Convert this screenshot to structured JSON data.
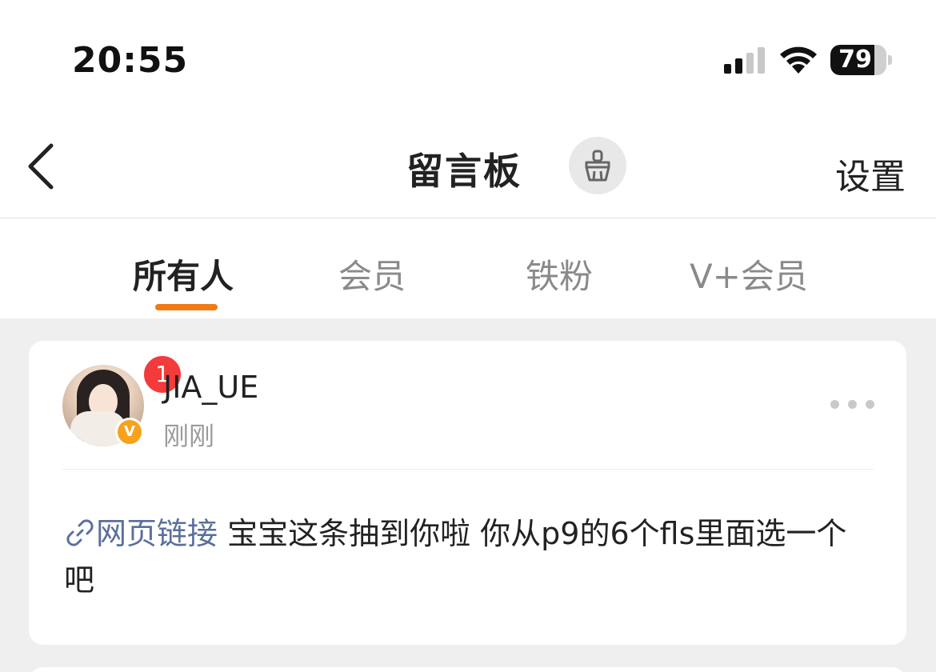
{
  "status_bar": {
    "time": "20:55",
    "battery_level": "79",
    "battery_fraction": 0.79,
    "signal_bars": 2
  },
  "nav": {
    "back_icon": "chevron-left-icon",
    "title": "留言板",
    "clean_icon": "broom-icon",
    "settings_label": "设置"
  },
  "tabs": [
    {
      "label": "所有人",
      "active": true
    },
    {
      "label": "会员",
      "active": false
    },
    {
      "label": "铁粉",
      "active": false
    },
    {
      "label": "V+会员",
      "active": false
    }
  ],
  "message": {
    "unread_count": "1",
    "verified_badge": "V",
    "username": "JIA_UE",
    "time_ago": "刚刚",
    "more_icon": "more-icon",
    "link_icon": "link-icon",
    "link_text": "网页链接",
    "body": " 宝宝这条抽到你啦 你从p9的6个fls里面选一个吧"
  },
  "colors": {
    "accent": "#f07b14",
    "link": "#5a6f9c",
    "badge_red": "#f43b3b",
    "verified": "#f7a21b",
    "page_bg": "#efefef"
  }
}
